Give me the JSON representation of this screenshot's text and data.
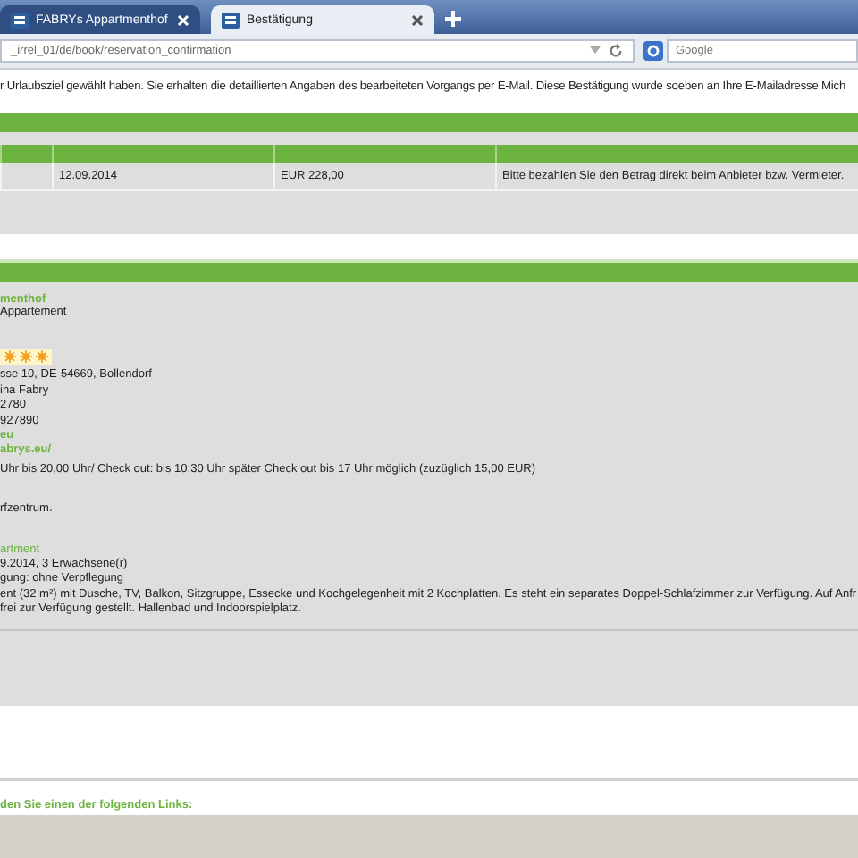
{
  "tabs": [
    {
      "label": "FABRYs Appartmenthof",
      "selected": false
    },
    {
      "label": "Bestätigung",
      "selected": true
    }
  ],
  "address_bar": {
    "url": "_irrel_01/de/book/reservation_confirmation",
    "search_placeholder": "Google"
  },
  "intro": "r Urlaubsziel gewählt haben. Sie erhalten die detaillierten Angaben des bearbeiteten Vorgangs per E-Mail. Diese Bestätigung wurde soeben an Ihre E-Mailadresse Mich",
  "booking_table": {
    "rows": [
      {
        "cells": [
          "",
          "12.09.2014",
          "EUR 228,00",
          "Bitte bezahlen Sie den Betrag direkt beim Anbieter bzw. Vermieter."
        ]
      }
    ]
  },
  "details": {
    "name": "menthof",
    "type": "Appartement",
    "stars": 3,
    "contact_lines": [
      "sse 10, DE-54669, Bollendorf",
      "ina Fabry",
      "2780",
      "927890"
    ],
    "links": [
      "eu",
      "abrys.eu/"
    ],
    "checkin": "Uhr bis 20,00 Uhr/ Check out: bis 10:30 Uhr später Check out bis 17 Uhr möglich (zuzüglich 15,00 EUR)",
    "location": "rfzentrum.",
    "unit_title": "artment",
    "unit_lines": [
      "9.2014, 3 Erwachsene(r)",
      "gung:  ohne Verpflegung",
      "ent (32 m²) mit Dusche, TV, Balkon, Sitzgruppe, Essecke und Kochgelegenheit mit 2 Kochplatten. Es steht ein separates Doppel-Schlafzimmer zur Verfügung. Auf Anfr",
      "frei zur Verfügung gestellt. Hallenbad und Indoorspielplatz."
    ]
  },
  "links_heading": "den Sie einen der folgenden Links:"
}
